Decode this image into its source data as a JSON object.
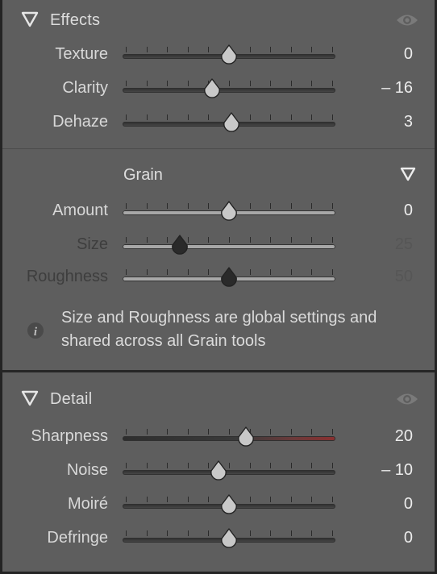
{
  "effects": {
    "title": "Effects",
    "rows": [
      {
        "label": "Texture",
        "value": "0",
        "position": 0.5,
        "dim": false
      },
      {
        "label": "Clarity",
        "value": "– 16",
        "position": 0.42,
        "dim": false
      },
      {
        "label": "Dehaze",
        "value": "3",
        "position": 0.51,
        "dim": false
      }
    ]
  },
  "grain": {
    "title": "Grain",
    "rows": [
      {
        "label": "Amount",
        "value": "0",
        "position": 0.5,
        "dim": false
      },
      {
        "label": "Size",
        "value": "25",
        "position": 0.27,
        "dim": true
      },
      {
        "label": "Roughness",
        "value": "50",
        "position": 0.5,
        "dim": true
      }
    ],
    "info": "Size and Roughness are global settings and shared across all Grain tools"
  },
  "detail": {
    "title": "Detail",
    "rows": [
      {
        "label": "Sharpness",
        "value": "20",
        "position": 0.58,
        "dim": false
      },
      {
        "label": "Noise",
        "value": "– 10",
        "position": 0.45,
        "dim": false
      },
      {
        "label": "Moiré",
        "value": "0",
        "position": 0.5,
        "dim": false
      },
      {
        "label": "Defringe",
        "value": "0",
        "position": 0.5,
        "dim": false
      }
    ]
  },
  "colors": {
    "panel_bg": "#5e5e5e",
    "divider": "#242424",
    "text": "#d8d8d8",
    "dim_text": "#3e3e3e",
    "thumb": "#c8c8c8",
    "thumb_dim": "#2a2a2a",
    "sharpen_accent": "#8a3030"
  },
  "icons": {
    "collapse": "triangle-down-icon",
    "visibility": "eye-icon",
    "info": "info-icon"
  }
}
